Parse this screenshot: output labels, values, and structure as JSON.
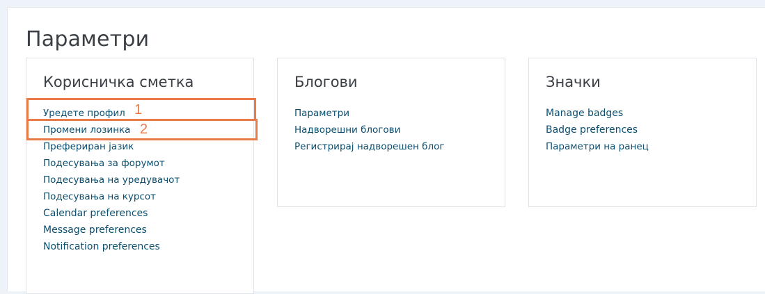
{
  "page": {
    "title": "Параметри"
  },
  "cards": {
    "account": {
      "title": "Корисничка сметка",
      "links": [
        "Уредете профил",
        "Промени лозинка",
        "Преферирaн јазик",
        "Подесувања за форумот",
        "Подесувања на уредувачот",
        "Подесувања на курсот",
        "Calendar preferences",
        "Message preferences",
        "Notification preferences"
      ]
    },
    "blogs": {
      "title": "Блогови",
      "links": [
        "Параметри",
        "Надворешни блогови",
        "Регистрирај надворешен блог"
      ]
    },
    "badges": {
      "title": "Значки",
      "links": [
        "Manage badges",
        "Badge preferences",
        "Параметри на ранец"
      ]
    }
  },
  "annotations": {
    "color": "#ea7a47",
    "labels": [
      "1",
      "2"
    ]
  }
}
